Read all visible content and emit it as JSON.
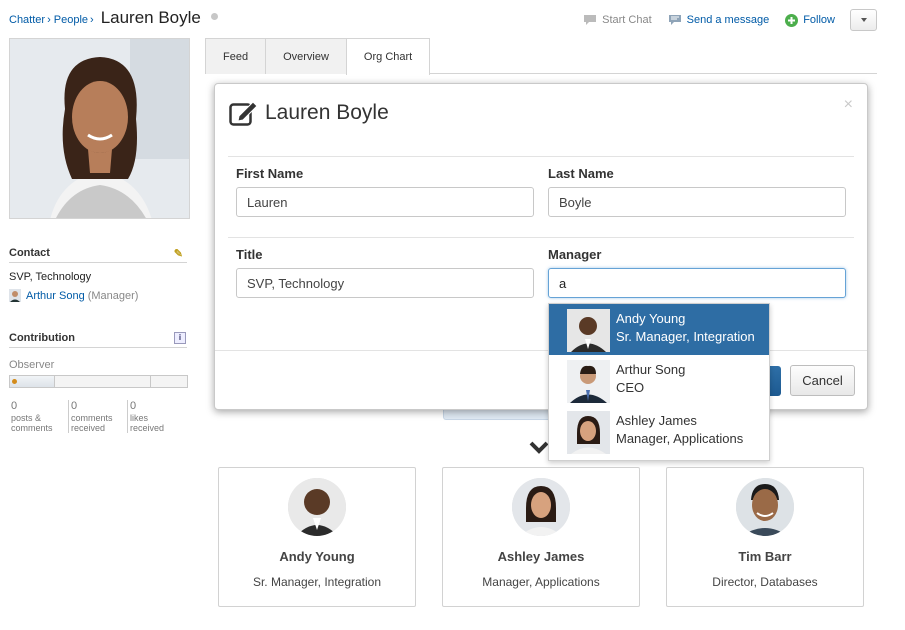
{
  "breadcrumb": {
    "items": [
      "Chatter",
      "People"
    ],
    "separator": "›",
    "current": "Lauren Boyle"
  },
  "header_actions": {
    "start_chat": "Start Chat",
    "send_message": "Send a message",
    "follow": "Follow"
  },
  "tabs": [
    {
      "label": "Feed"
    },
    {
      "label": "Overview"
    },
    {
      "label": "Org Chart",
      "active": true
    }
  ],
  "contact": {
    "title": "Contact",
    "role": "SVP, Technology",
    "manager_name": "Arthur Song",
    "manager_suffix": "(Manager)"
  },
  "contribution": {
    "title": "Contribution",
    "level": "Observer",
    "stats": [
      {
        "value": "0",
        "label_1": "posts &",
        "label_2": "comments"
      },
      {
        "value": "0",
        "label_1": "comments",
        "label_2": "received"
      },
      {
        "value": "0",
        "label_1": "likes",
        "label_2": "received"
      }
    ]
  },
  "modal": {
    "title": "Lauren Boyle",
    "close_glyph": "×",
    "first_name": {
      "label": "First Name",
      "value": "Lauren"
    },
    "last_name": {
      "label": "Last Name",
      "value": "Boyle"
    },
    "title_field": {
      "label": "Title",
      "value": "SVP, Technology"
    },
    "manager": {
      "label": "Manager",
      "value": "a"
    },
    "cancel": "Cancel"
  },
  "manager_suggestions": [
    {
      "name": "Andy Young",
      "role": "Sr. Manager, Integration",
      "highlighted": true
    },
    {
      "name": "Arthur Song",
      "role": "CEO"
    },
    {
      "name": "Ashley James",
      "role": "Manager, Applications"
    }
  ],
  "org_cards": [
    {
      "name": "Andy Young",
      "role": "Sr. Manager, Integration"
    },
    {
      "name": "Ashley James",
      "role": "Manager, Applications"
    },
    {
      "name": "Tim Barr",
      "role": "Director, Databases"
    }
  ],
  "colors": {
    "link": "#015ba7",
    "accent": "#2e6da4",
    "follow_green": "#4cae4c"
  },
  "icons": [
    "chat-bubble-icon",
    "message-icon",
    "plus-circle-icon",
    "pencil-icon",
    "info-icon",
    "edit-square-icon",
    "chevron-down-icon",
    "close-icon"
  ]
}
